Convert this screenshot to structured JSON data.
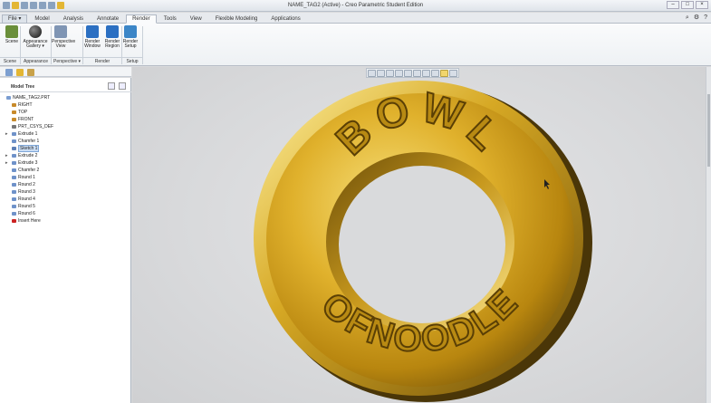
{
  "window": {
    "title": "NAME_TAG2 (Active) - Creo Parametric Student Edition"
  },
  "tabs": [
    "File ▾",
    "Model",
    "Analysis",
    "Annotate",
    "Render",
    "Tools",
    "View",
    "Flexible Modeling",
    "Applications"
  ],
  "active_tab": "Render",
  "ribbon": {
    "buttons": [
      {
        "label": "Scene",
        "icon": "scene-icon",
        "color": "#6a8f3a"
      },
      {
        "label": "Appearance Gallery ▾",
        "icon": "appearance-sphere-icon",
        "color": "#1d1d1d"
      },
      {
        "label": "Perspective View",
        "icon": "perspective-view-icon",
        "color": "#7f95b4"
      },
      {
        "label": "Render Window",
        "icon": "render-window-icon",
        "color": "#2b6fc2"
      },
      {
        "label": "Render Region",
        "icon": "render-region-icon",
        "color": "#2b6fc2"
      },
      {
        "label": "Render Setup",
        "icon": "render-setup-icon",
        "color": "#3c86c7"
      }
    ],
    "groups": [
      "Scene",
      "Appearance",
      "Perspective ▾",
      "Render",
      "Setup"
    ]
  },
  "model_tree": {
    "header": "Model Tree",
    "items": [
      {
        "label": "NAME_TAG2.PRT",
        "icon": "part-icon",
        "color": "#7a9dd1",
        "expand": "",
        "indent": 0
      },
      {
        "label": "RIGHT",
        "icon": "datum-plane-icon",
        "color": "#c88a2a",
        "expand": "",
        "indent": 1
      },
      {
        "label": "TOP",
        "icon": "datum-plane-icon",
        "color": "#c88a2a",
        "expand": "",
        "indent": 1
      },
      {
        "label": "FRONT",
        "icon": "datum-plane-icon",
        "color": "#c88a2a",
        "expand": "",
        "indent": 1
      },
      {
        "label": "PRT_CSYS_DEF",
        "icon": "csys-icon",
        "color": "#777777",
        "expand": "",
        "indent": 1
      },
      {
        "label": "Extrude 1",
        "icon": "extrude-icon",
        "color": "#6f92c9",
        "expand": "▸",
        "indent": 1
      },
      {
        "label": "Chamfer 1",
        "icon": "chamfer-icon",
        "color": "#6f92c9",
        "expand": "",
        "indent": 1
      },
      {
        "label": "Sketch 1",
        "icon": "sketch-icon",
        "color": "#5d7fb6",
        "expand": "",
        "indent": 1,
        "selected": true
      },
      {
        "label": "Extrude 2",
        "icon": "extrude-icon",
        "color": "#6f92c9",
        "expand": "▸",
        "indent": 1
      },
      {
        "label": "Extrude 3",
        "icon": "extrude-icon",
        "color": "#6f92c9",
        "expand": "▸",
        "indent": 1
      },
      {
        "label": "Chamfer 2",
        "icon": "chamfer-icon",
        "color": "#6f92c9",
        "expand": "",
        "indent": 1
      },
      {
        "label": "Round 1",
        "icon": "round-icon",
        "color": "#6f92c9",
        "expand": "",
        "indent": 1
      },
      {
        "label": "Round 2",
        "icon": "round-icon",
        "color": "#6f92c9",
        "expand": "",
        "indent": 1
      },
      {
        "label": "Round 3",
        "icon": "round-icon",
        "color": "#6f92c9",
        "expand": "",
        "indent": 1
      },
      {
        "label": "Round 4",
        "icon": "round-icon",
        "color": "#6f92c9",
        "expand": "",
        "indent": 1
      },
      {
        "label": "Round 5",
        "icon": "round-icon",
        "color": "#6f92c9",
        "expand": "",
        "indent": 1
      },
      {
        "label": "Round 6",
        "icon": "round-icon",
        "color": "#6f92c9",
        "expand": "",
        "indent": 1
      },
      {
        "label": "Insert Here",
        "icon": "insert-here-icon",
        "color": "#cc2222",
        "expand": "",
        "indent": 1
      }
    ]
  },
  "model": {
    "top_text": "BOWL",
    "bottom_text": "OFNOODLE",
    "colors": {
      "gold_light": "#f7e07a",
      "gold_mid": "#d4a521",
      "gold_dark": "#7d5a0a",
      "background": "#d9dadc"
    }
  },
  "view_toolbar": [
    "refit-icon",
    "zoom-in-icon",
    "zoom-out-icon",
    "repaint-icon",
    "named-views-icon",
    "display-style-icon",
    "view-manager-icon",
    "datum-display-icon",
    "spin-center-icon",
    "annotation-display-icon"
  ]
}
